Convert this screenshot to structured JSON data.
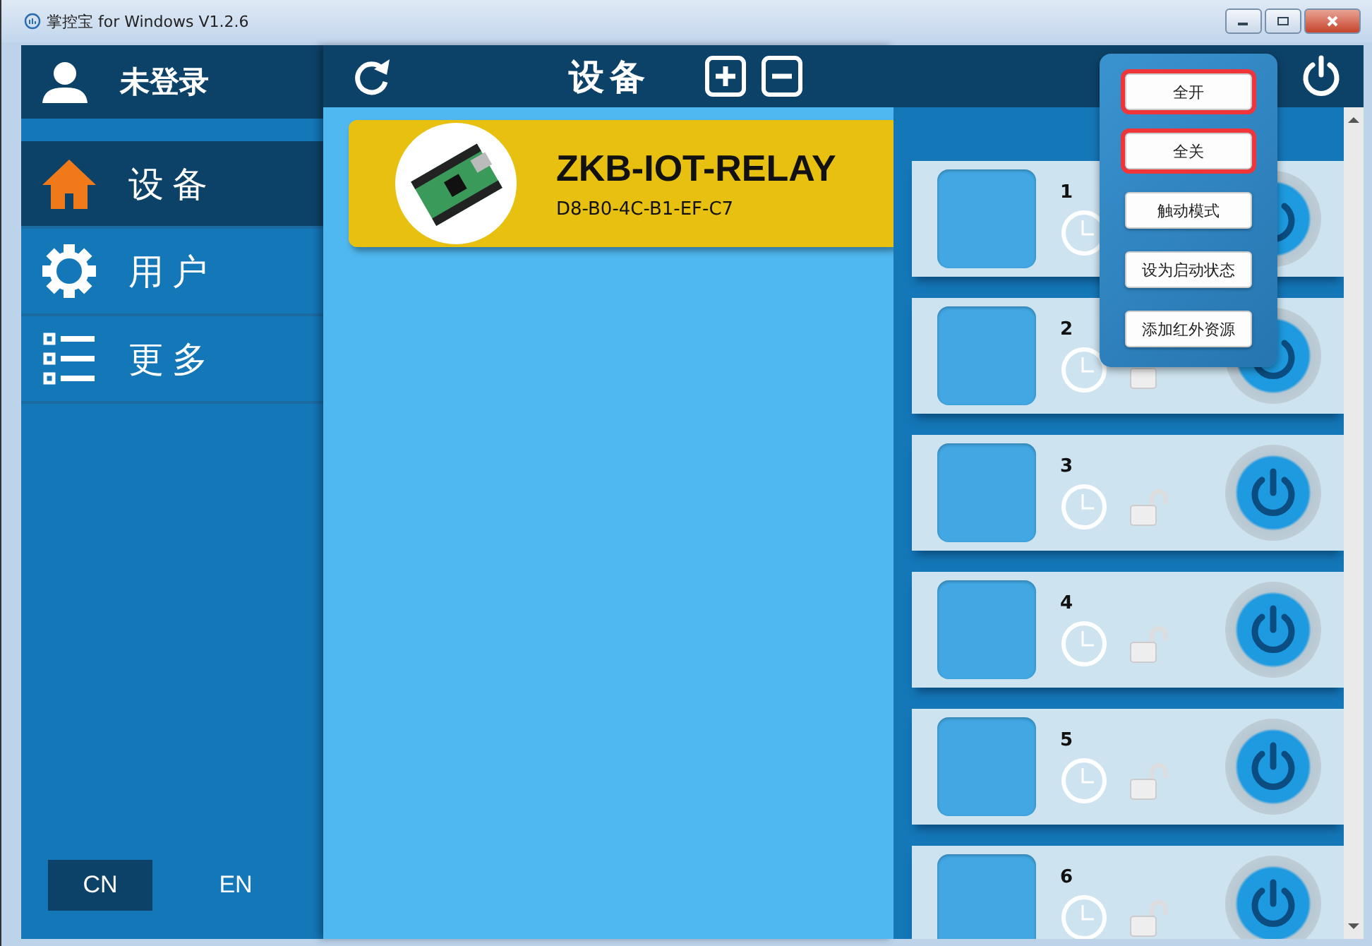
{
  "window": {
    "title": "掌控宝 for Windows V1.2.6"
  },
  "sidebar": {
    "user": "未登录",
    "items": [
      {
        "label": "设备",
        "selected": true
      },
      {
        "label": "用户",
        "selected": false
      },
      {
        "label": "更多",
        "selected": false
      }
    ],
    "languages": [
      {
        "label": "CN",
        "selected": true
      },
      {
        "label": "EN",
        "selected": false
      }
    ]
  },
  "devices_panel": {
    "title": "设备",
    "devices": [
      {
        "name": "ZKB-IOT-RELAY",
        "mac": "D8-B0-4C-B1-EF-C7"
      }
    ]
  },
  "channels": [
    {
      "number": "1"
    },
    {
      "number": "2"
    },
    {
      "number": "3"
    },
    {
      "number": "4"
    },
    {
      "number": "5"
    },
    {
      "number": "6"
    }
  ],
  "popup_menu": [
    {
      "label": "全开",
      "highlighted": true
    },
    {
      "label": "全关",
      "highlighted": true
    },
    {
      "label": "触动模式",
      "highlighted": false
    },
    {
      "label": "设为启动状态",
      "highlighted": false
    },
    {
      "label": "添加红外资源",
      "highlighted": false
    }
  ]
}
